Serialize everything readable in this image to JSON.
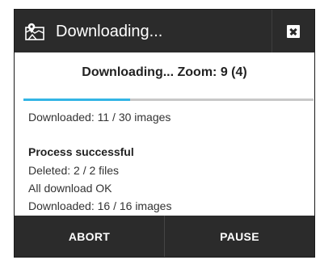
{
  "dialog": {
    "title": "Downloading...",
    "icon": "map-icon",
    "close_icon": "close-icon"
  },
  "progress": {
    "heading": "Downloading... Zoom: 9 (4)",
    "fraction": 0.367,
    "downloaded": "Downloaded: 11 / 30 images",
    "accent": "#33b5e5"
  },
  "log": {
    "line1": "Process successful",
    "line2": "Deleted: 2 / 2 files",
    "line3": "All download OK",
    "line4": "Downloaded: 16 / 16 images"
  },
  "buttons": {
    "abort": "ABORT",
    "pause": "PAUSE"
  }
}
